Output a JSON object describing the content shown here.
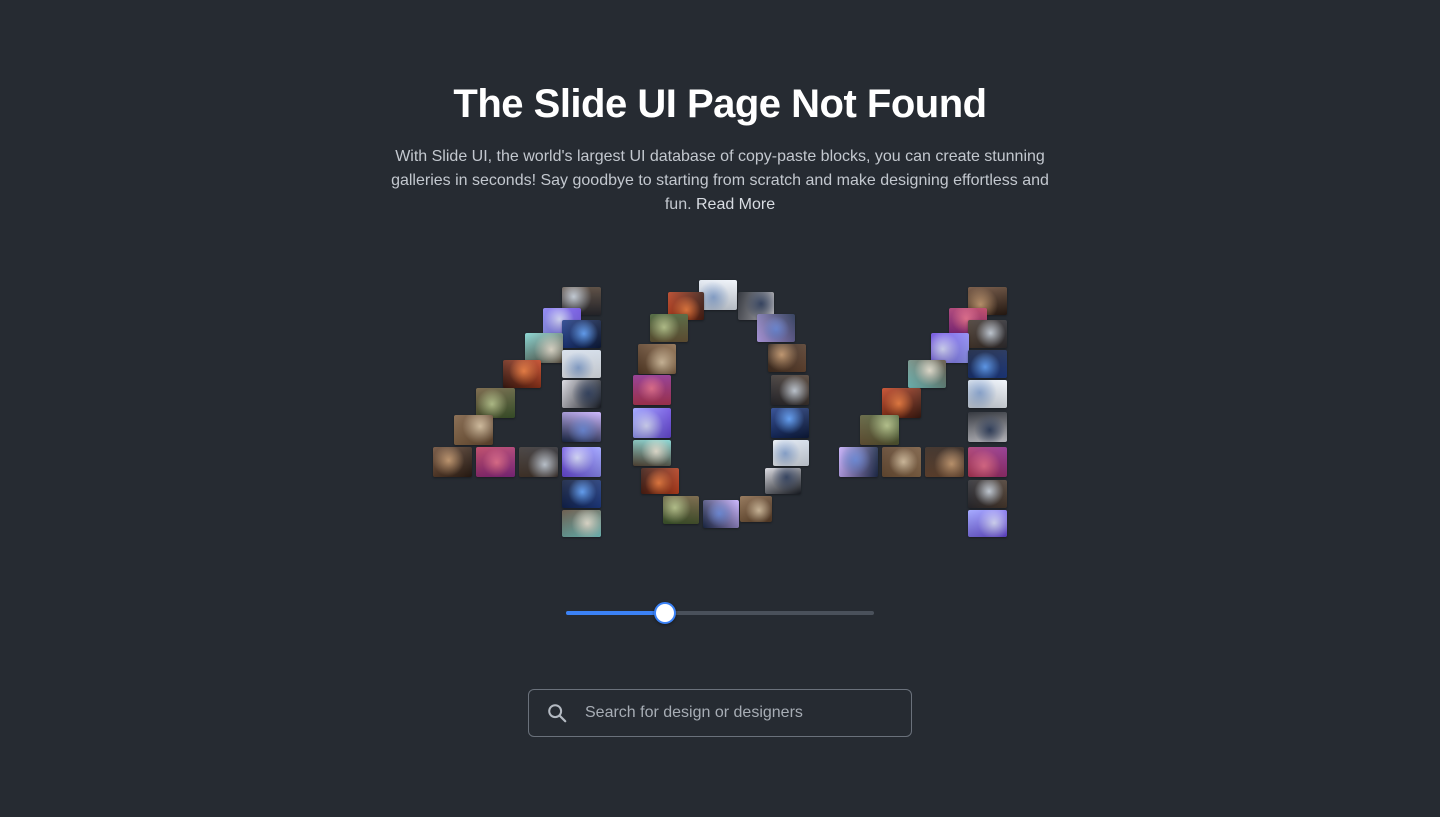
{
  "header": {
    "title": "The Slide UI Page Not Found",
    "description": "With Slide UI, the world's largest UI database of copy-paste blocks, you can create stunning galleries in seconds! Say goodbye to starting from scratch and make designing effortless and fun.",
    "read_more_label": "Read More"
  },
  "slider": {
    "value": 0.32
  },
  "search": {
    "placeholder": "Search for design or designers",
    "value": ""
  },
  "colors": {
    "background": "#262b32",
    "accent": "#3b82f6",
    "text_muted": "#c3c8cf"
  },
  "icons": {
    "search": "search-icon"
  }
}
